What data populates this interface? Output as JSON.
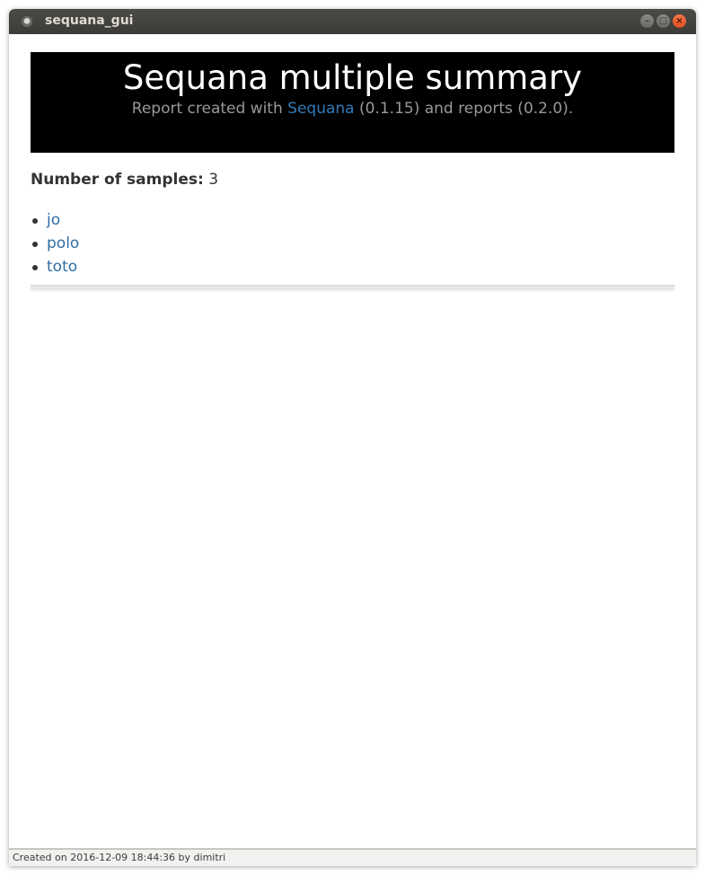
{
  "window": {
    "title": "sequana_gui",
    "buttons": {
      "minimize": "–",
      "maximize": "□",
      "close": "×"
    }
  },
  "report": {
    "title": "Sequana multiple summary",
    "subtitle_prefix": "Report created with ",
    "subtitle_link": "Sequana",
    "subtitle_suffix": " (0.1.15) and reports (0.2.0).",
    "samples_label": "Number of samples:",
    "samples_count": "3",
    "samples": [
      {
        "name": "jo"
      },
      {
        "name": "polo"
      },
      {
        "name": "toto"
      }
    ]
  },
  "status": {
    "text": "Created on 2016-12-09 18:44:36 by dimitri"
  },
  "colors": {
    "banner_bg": "#000000",
    "link": "#337ab7",
    "titlebar": "#3c3b37",
    "close_button": "#e0501d"
  }
}
